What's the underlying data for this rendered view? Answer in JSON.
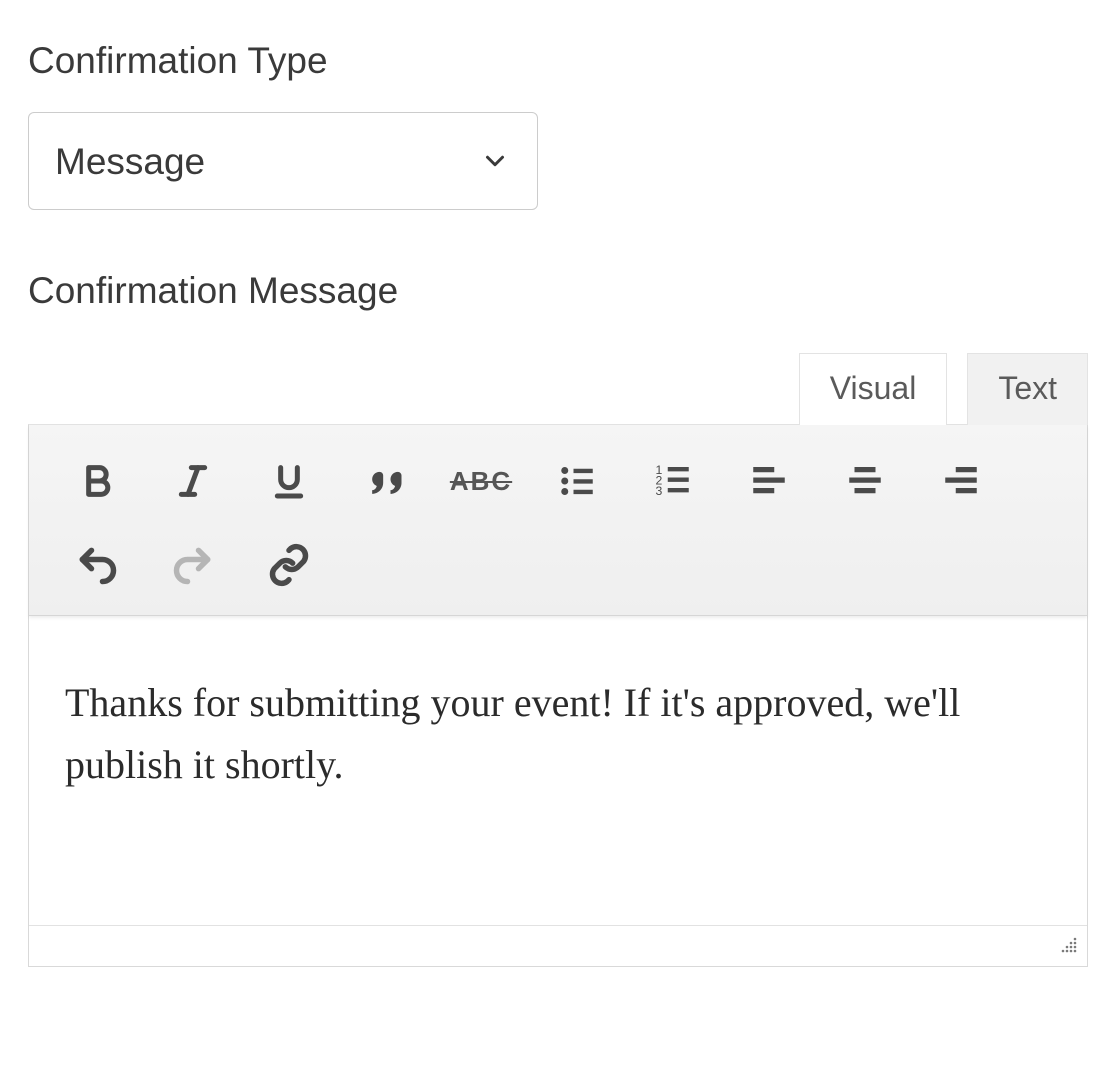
{
  "labels": {
    "confirmation_type": "Confirmation Type",
    "confirmation_message": "Confirmation Message"
  },
  "confirmation_type": {
    "value": "Message",
    "options": [
      "Message"
    ]
  },
  "editor": {
    "tabs": {
      "visual": "Visual",
      "text": "Text",
      "active": "visual"
    },
    "content": "Thanks for submitting your event! If it's approved, we'll publish it shortly.",
    "toolbar": [
      {
        "name": "bold",
        "icon": "bold"
      },
      {
        "name": "italic",
        "icon": "italic"
      },
      {
        "name": "underline",
        "icon": "underline"
      },
      {
        "name": "blockquote",
        "icon": "quote"
      },
      {
        "name": "strikethrough",
        "icon": "abc-strike"
      },
      {
        "name": "bulleted-list",
        "icon": "ul"
      },
      {
        "name": "numbered-list",
        "icon": "ol"
      },
      {
        "name": "align-left",
        "icon": "align-left"
      },
      {
        "name": "align-center",
        "icon": "align-center"
      },
      {
        "name": "align-right",
        "icon": "align-right"
      },
      {
        "name": "undo",
        "icon": "undo"
      },
      {
        "name": "redo",
        "icon": "redo",
        "dim": true
      },
      {
        "name": "insert-link",
        "icon": "link"
      }
    ]
  }
}
